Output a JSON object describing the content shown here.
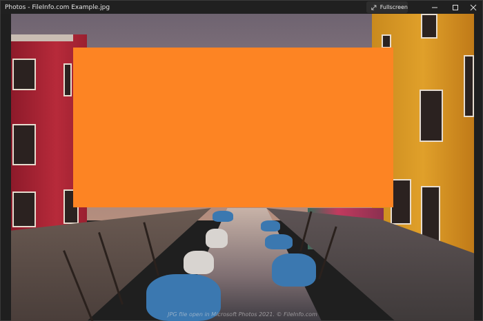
{
  "window": {
    "title": "Photos - FileInfo.com Example.jpg",
    "fullscreen_label": "Fullscreen",
    "controls": [
      "minimize-icon",
      "maximize-icon",
      "close-icon"
    ]
  },
  "photo": {
    "caption": "JPG file open in Microsoft Photos 2021. © FileInfo.com",
    "overlay_color": "#fd8423"
  }
}
